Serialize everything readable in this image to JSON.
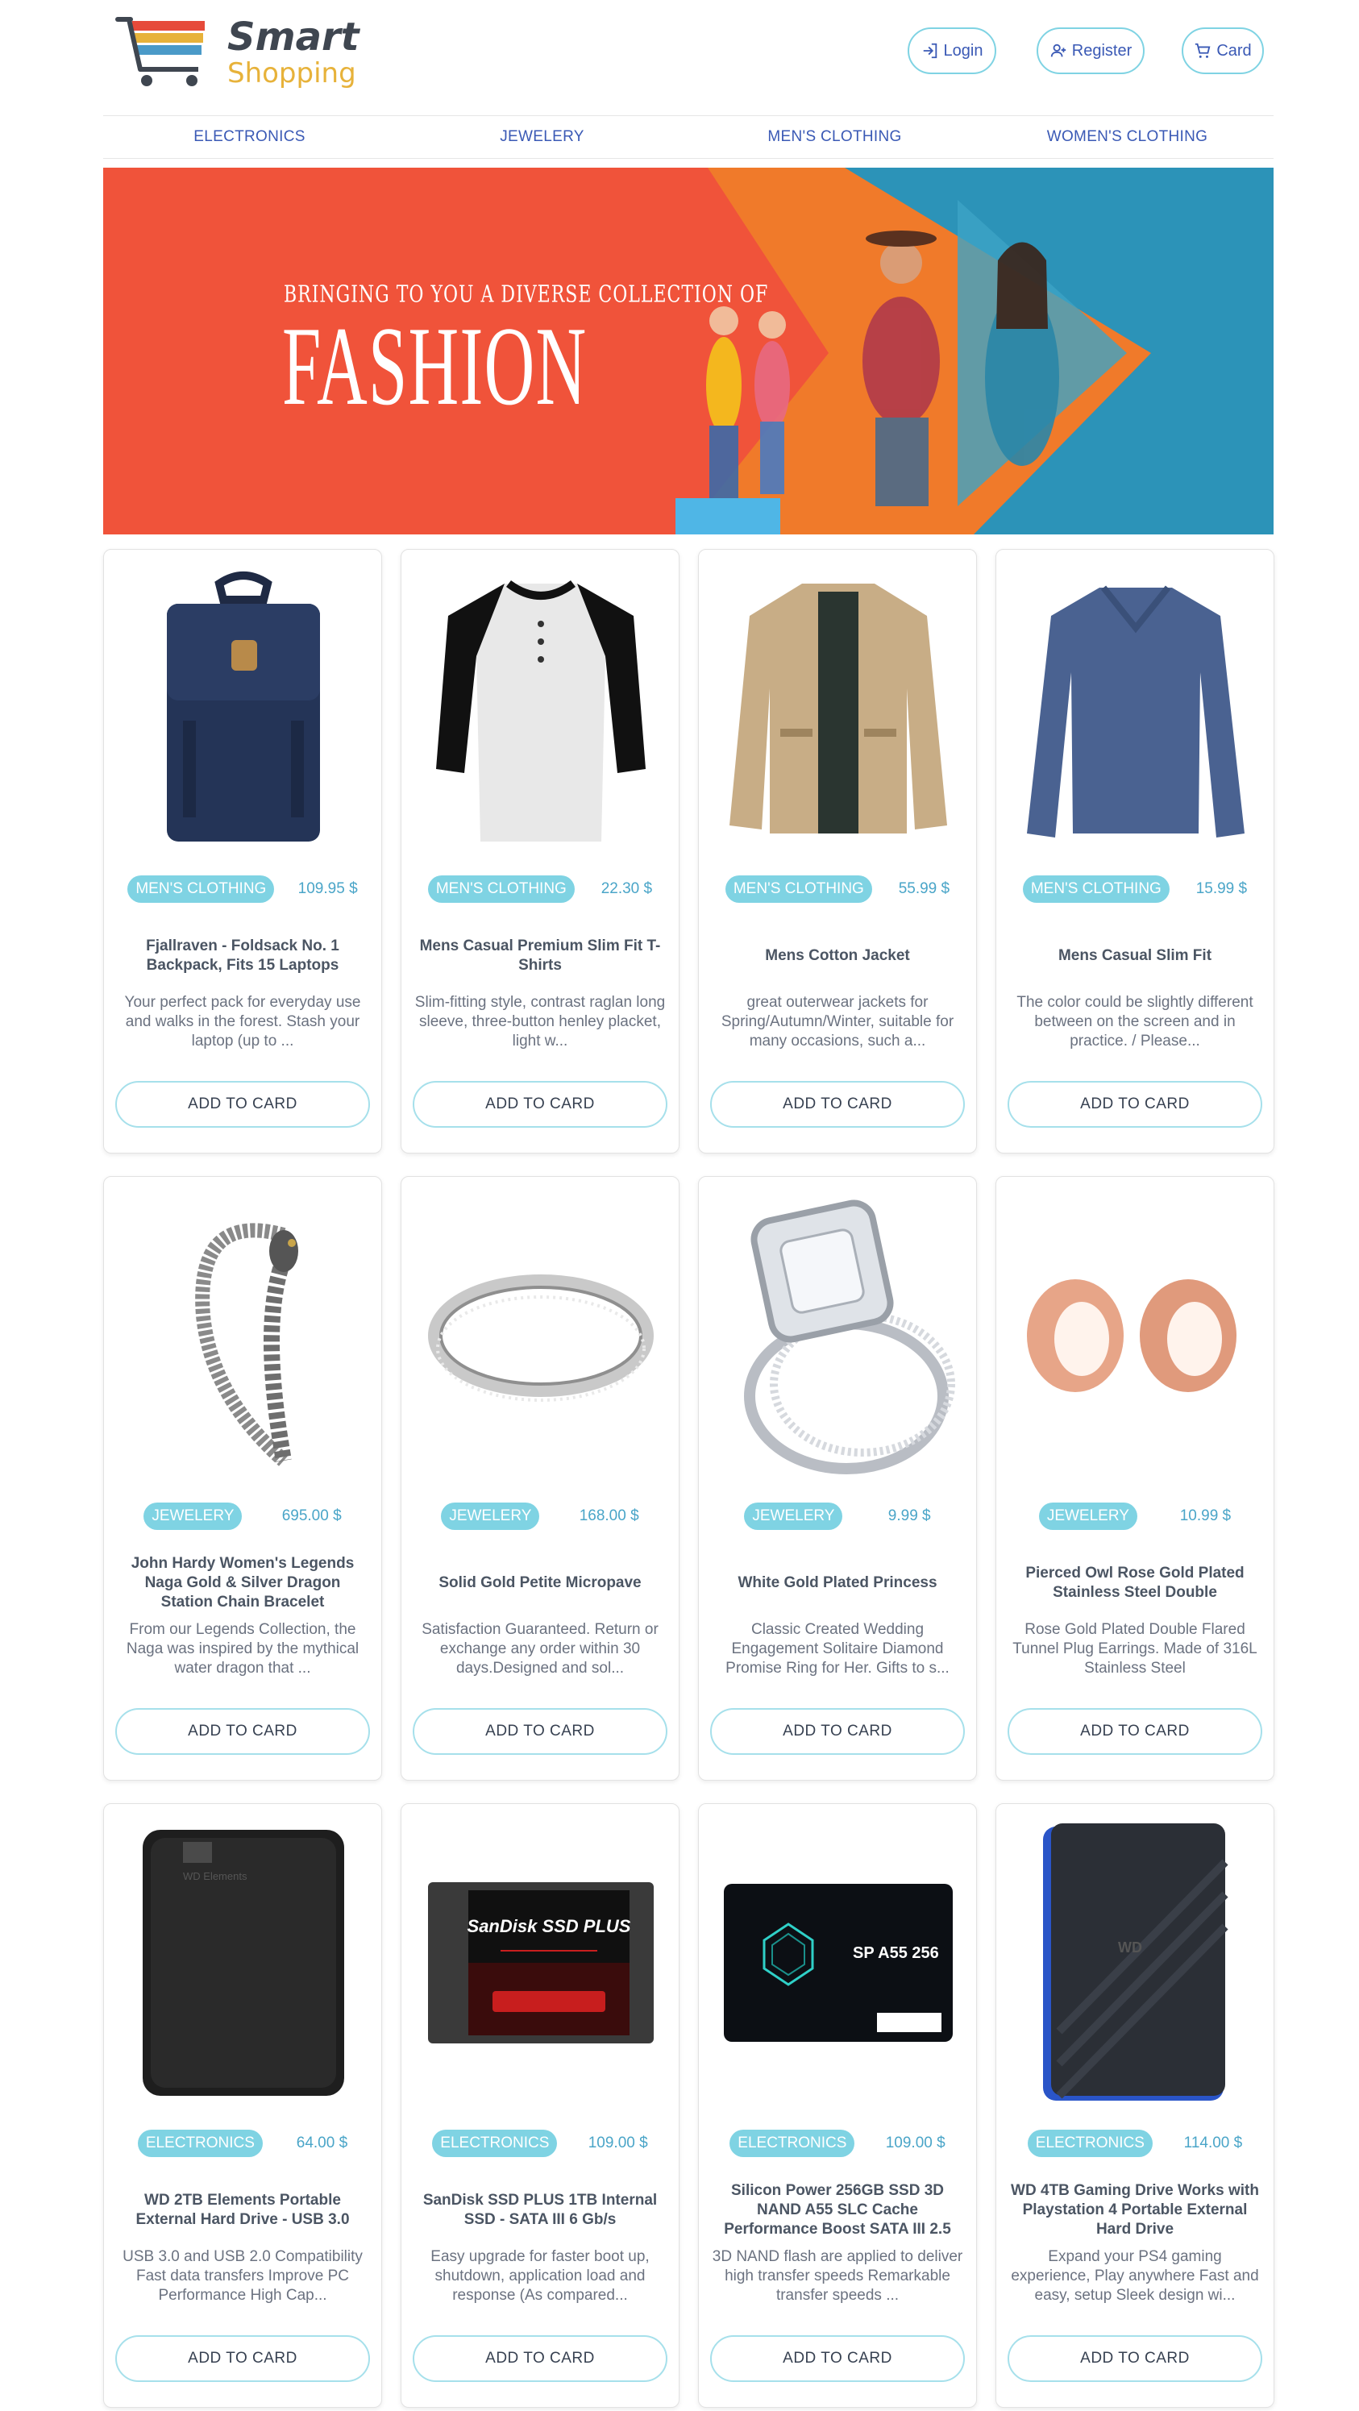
{
  "brand": {
    "name_line1": "Smart",
    "name_line2": "Shopping"
  },
  "header": {
    "login_label": "Login",
    "register_label": "Register",
    "card_label": "Card"
  },
  "nav": {
    "items": [
      {
        "label": "ELECTRONICS"
      },
      {
        "label": "JEWELERY"
      },
      {
        "label": "MEN'S CLOTHING"
      },
      {
        "label": "WOMEN'S CLOTHING"
      }
    ]
  },
  "banner": {
    "subtitle": "BRINGING TO YOU A DIVERSE COLLECTION OF",
    "title": "FASHION"
  },
  "products": [
    {
      "category": "MEN'S CLOTHING",
      "price": "109.95 $",
      "title": "Fjallraven - Foldsack No. 1 Backpack, Fits 15 Laptops",
      "description": "Your perfect pack for everyday use and walks in the forest. Stash your laptop (up to ...",
      "button": "ADD TO CARD",
      "image": "backpack"
    },
    {
      "category": "MEN'S CLOTHING",
      "price": "22.30 $",
      "title": "Mens Casual Premium Slim Fit T-Shirts",
      "description": "Slim-fitting style, contrast raglan long sleeve, three-button henley placket, light w...",
      "button": "ADD TO CARD",
      "image": "tshirt"
    },
    {
      "category": "MEN'S CLOTHING",
      "price": "55.99 $",
      "title": "Mens Cotton Jacket",
      "description": "great outerwear jackets for Spring/Autumn/Winter, suitable for many occasions, such a...",
      "button": "ADD TO CARD",
      "image": "jacket"
    },
    {
      "category": "MEN'S CLOTHING",
      "price": "15.99 $",
      "title": "Mens Casual Slim Fit",
      "description": "The color could be slightly different between on the screen and in practice. / Please...",
      "button": "ADD TO CARD",
      "image": "longsleeve"
    },
    {
      "category": "JEWELERY",
      "price": "695.00 $",
      "title": "John Hardy Women's Legends Naga Gold & Silver Dragon Station Chain Bracelet",
      "description": "From our Legends Collection, the Naga was inspired by the mythical water dragon that ...",
      "button": "ADD TO CARD",
      "image": "bracelet"
    },
    {
      "category": "JEWELERY",
      "price": "168.00 $",
      "title": "Solid Gold Petite Micropave",
      "description": "Satisfaction Guaranteed. Return or exchange any order within 30 days.Designed and sol...",
      "button": "ADD TO CARD",
      "image": "ring"
    },
    {
      "category": "JEWELERY",
      "price": "9.99 $",
      "title": "White Gold Plated Princess",
      "description": "Classic Created Wedding Engagement Solitaire Diamond Promise Ring for Her. Gifts to s...",
      "button": "ADD TO CARD",
      "image": "diamond-ring"
    },
    {
      "category": "JEWELERY",
      "price": "10.99 $",
      "title": "Pierced Owl Rose Gold Plated Stainless Steel Double",
      "description": "Rose Gold Plated Double Flared Tunnel Plug Earrings. Made of 316L Stainless Steel",
      "button": "ADD TO CARD",
      "image": "plugs"
    },
    {
      "category": "ELECTRONICS",
      "price": "64.00 $",
      "title": "WD 2TB Elements Portable External Hard Drive - USB 3.0",
      "description": "USB 3.0 and USB 2.0 Compatibility Fast data transfers Improve PC Performance High Cap...",
      "button": "ADD TO CARD",
      "image": "hdd-black",
      "image_text": "WD Elements"
    },
    {
      "category": "ELECTRONICS",
      "price": "109.00 $",
      "title": "SanDisk SSD PLUS 1TB Internal SSD - SATA III 6 Gb/s",
      "description": "Easy upgrade for faster boot up, shutdown, application load and response (As compared...",
      "button": "ADD TO CARD",
      "image": "ssd-sandisk",
      "image_text": "SanDisk SSD PLUS"
    },
    {
      "category": "ELECTRONICS",
      "price": "109.00 $",
      "title": "Silicon Power 256GB SSD 3D NAND A55 SLC Cache Performance Boost SATA III 2.5",
      "description": "3D NAND flash are applied to deliver high transfer speeds Remarkable transfer speeds ...",
      "button": "ADD TO CARD",
      "image": "ssd-sp",
      "image_text": "SP A55 256"
    },
    {
      "category": "ELECTRONICS",
      "price": "114.00 $",
      "title": "WD 4TB Gaming Drive Works with Playstation 4 Portable External Hard Drive",
      "description": "Expand your PS4 gaming experience, Play anywhere Fast and easy, setup Sleek design wi...",
      "button": "ADD TO CARD",
      "image": "hdd-gaming",
      "image_text": "WD"
    }
  ]
}
